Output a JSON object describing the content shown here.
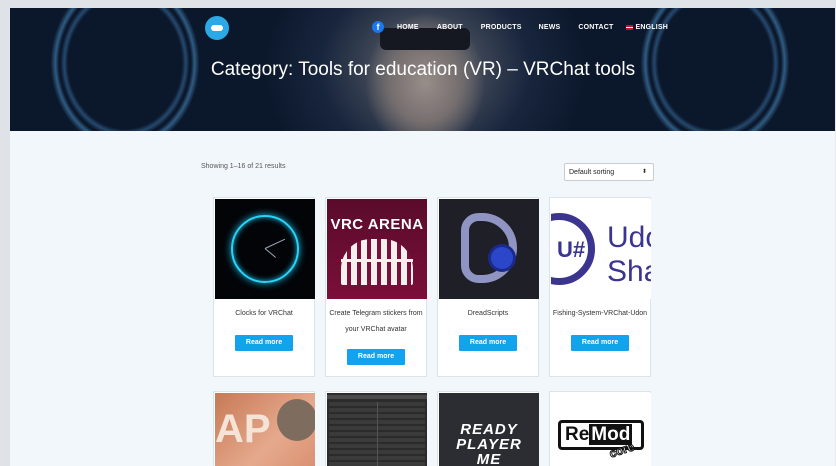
{
  "nav": {
    "facebook": "f",
    "items": [
      "HOME",
      "ABOUT",
      "PRODUCTS",
      "NEWS",
      "CONTACT"
    ],
    "language": "ENGLISH"
  },
  "hero": {
    "title": "Category: Tools for education (VR) – VRChat tools"
  },
  "shop": {
    "result_count": "Showing 1–16 of 21 results",
    "sort_selected": "Default sorting"
  },
  "products": [
    {
      "title": "Clocks for VRChat",
      "button": "Read more"
    },
    {
      "title": "Create Telegram stickers from your VRChat avatar",
      "button": "Read more",
      "thumb_text": "VRC ARENA"
    },
    {
      "title": "DreadScripts",
      "button": "Read more"
    },
    {
      "title": "Fishing-System-VRChat-Udon",
      "button": "Read more",
      "thumb_text_1": "U#",
      "thumb_text_2": "Udo",
      "thumb_text_3": "Sha"
    }
  ],
  "products_row2": [
    {
      "thumb_text": "AP"
    },
    {
      "thumb_text": ""
    },
    {
      "thumb_line_1": "READY",
      "thumb_line_2": "PLAYER",
      "thumb_line_3": "ME"
    },
    {
      "thumb_text_1": "Re",
      "thumb_text_2": "Mod",
      "thumb_text_3": "core"
    }
  ],
  "colors": {
    "accent": "#13a2ed",
    "page_bg": "#f2f7fb",
    "hero_overlay": "#1e2c44"
  },
  "icons": [
    "facebook-icon",
    "flag-uk-icon",
    "logo-icon",
    "chevron-updown-icon"
  ]
}
